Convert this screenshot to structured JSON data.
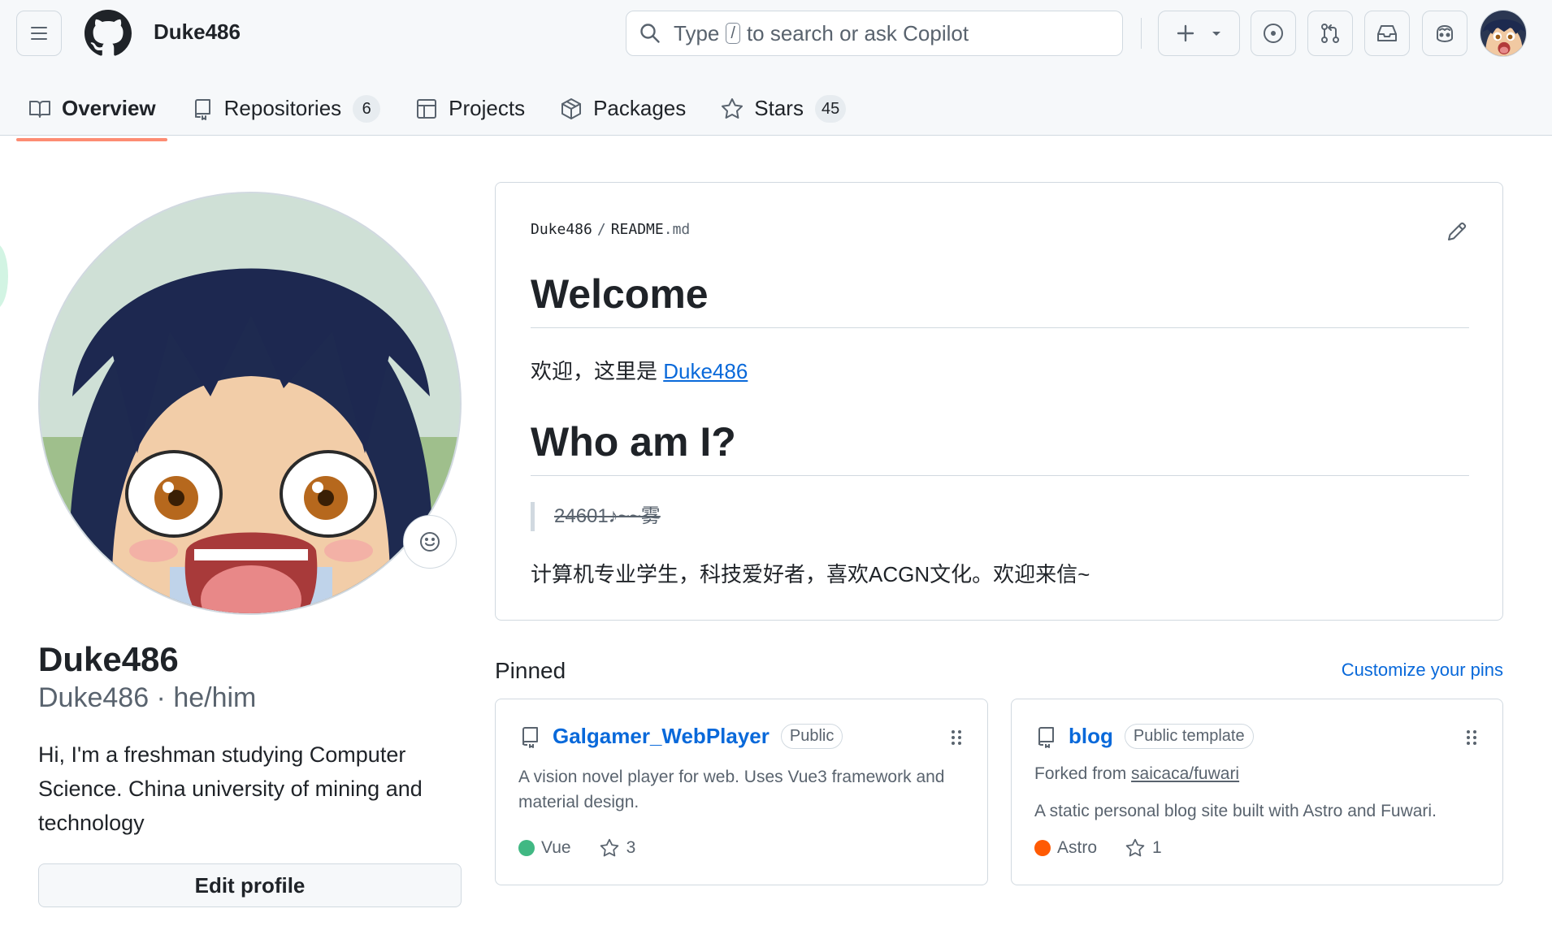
{
  "header": {
    "username": "Duke486",
    "search": {
      "prefix": "Type",
      "shortcut": "/",
      "suffix": "to search or ask Copilot"
    },
    "create_icon": "plus-icon",
    "header_icons": [
      "issues-icon",
      "pull-requests-icon",
      "inbox-icon",
      "copilot-icon"
    ]
  },
  "tabs": [
    {
      "label": "Overview",
      "icon": "book-icon",
      "active": true
    },
    {
      "label": "Repositories",
      "icon": "repo-icon",
      "count": "6"
    },
    {
      "label": "Projects",
      "icon": "table-icon"
    },
    {
      "label": "Packages",
      "icon": "package-icon"
    },
    {
      "label": "Stars",
      "icon": "star-icon",
      "count": "45"
    }
  ],
  "profile": {
    "name": "Duke486",
    "login_pronouns": "Duke486 · he/him",
    "bio": "Hi, I'm a freshman studying Computer Science. China university of mining and technology",
    "edit_label": "Edit profile"
  },
  "readme": {
    "path_owner": "Duke486",
    "path_sep": "/",
    "path_file": "README",
    "path_ext": ".md",
    "h1": "Welcome",
    "p1_prefix": "欢迎，这里是 ",
    "p1_link": "Duke486",
    "h2": "Who am I?",
    "quote": "24601♪~~雾",
    "p2": "计算机专业学生，科技爱好者，喜欢ACGN文化。欢迎来信~"
  },
  "pinned": {
    "title": "Pinned",
    "customize_label": "Customize your pins",
    "repos": [
      {
        "name": "Galgamer_WebPlayer",
        "badge": "Public",
        "description": "A vision novel player for web. Uses Vue3 framework and material design.",
        "language": "Vue",
        "language_color": "#41b883",
        "stars": "3"
      },
      {
        "name": "blog",
        "badge": "Public template",
        "forked_prefix": "Forked from",
        "forked_from": "saicaca/fuwari",
        "description": "A static personal blog site built with Astro and Fuwari.",
        "language": "Astro",
        "language_color": "#ff5a03",
        "stars": "1"
      }
    ]
  },
  "colors": {
    "accent_link": "#0969da",
    "tab_underline": "#fd8c73",
    "header_bg": "#f6f8fa",
    "border": "#d1d9e0"
  }
}
